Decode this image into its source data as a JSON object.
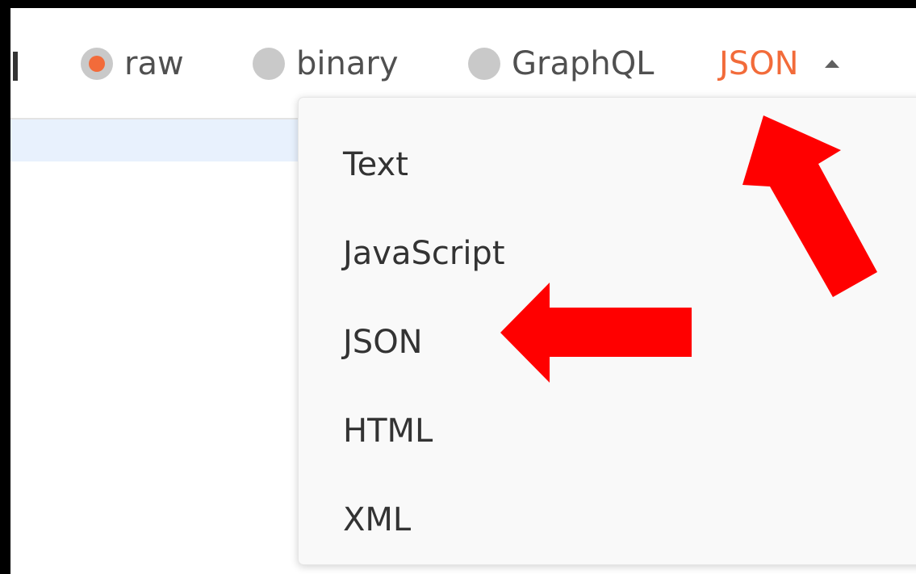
{
  "body_toolbar": {
    "options": [
      {
        "label": "raw",
        "selected": true,
        "icon": "radio-selected-icon"
      },
      {
        "label": "binary",
        "selected": false,
        "icon": "radio-unselected-icon"
      },
      {
        "label": "GraphQL",
        "selected": false,
        "icon": "radio-unselected-icon"
      }
    ],
    "format_selector": {
      "value": "JSON",
      "icon": "caret-up-icon",
      "expanded": true
    }
  },
  "format_menu": {
    "items": [
      "Text",
      "JavaScript",
      "JSON",
      "HTML",
      "XML"
    ]
  },
  "annotations": [
    {
      "icon": "red-arrow-icon",
      "points_to": "format_selector"
    },
    {
      "icon": "red-arrow-icon",
      "points_to": "menu_item_json"
    }
  ],
  "colors": {
    "accent": "#f26b3a",
    "radio_gray": "#c9c9c9",
    "active_line": "#e8f1fd",
    "annotation_red": "#ff0000"
  }
}
